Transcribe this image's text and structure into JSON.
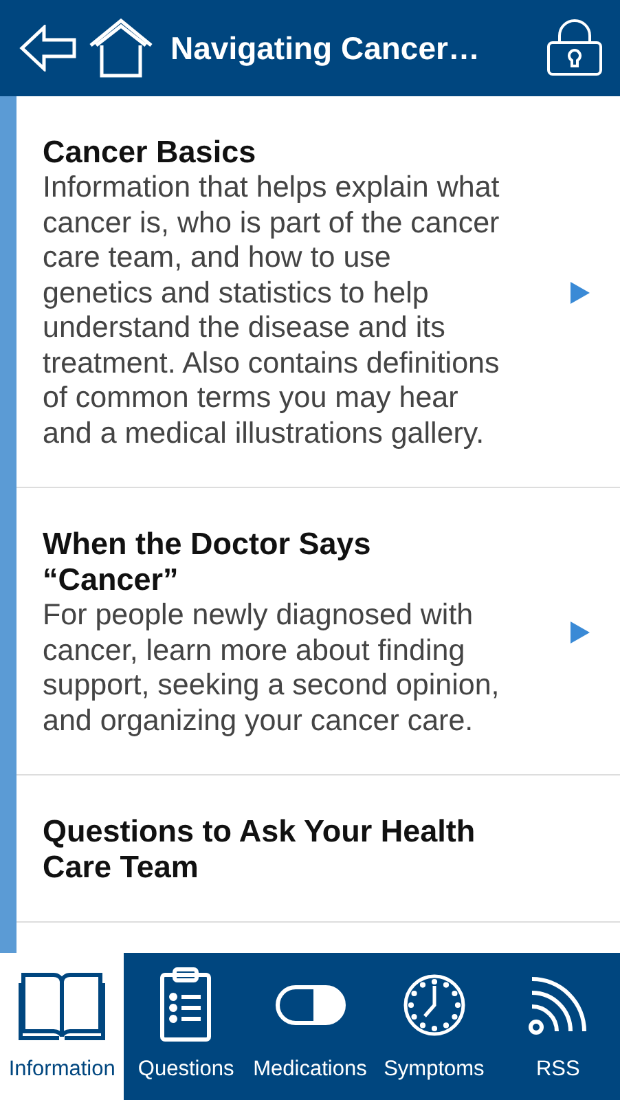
{
  "header": {
    "title": "Navigating Cancer…"
  },
  "items": [
    {
      "title": "Cancer Basics",
      "description": "Information that helps explain what cancer is, who is part of the cancer care team, and how to use genetics and statistics to help understand the disease and its treatment. Also contains definitions of common terms you may hear and a medical illustrations gallery."
    },
    {
      "title": "When the Doctor Says “Cancer”",
      "description": "For people newly diagnosed with cancer, learn more about finding support, seeking a second opinion, and organizing your cancer care."
    },
    {
      "title": "Questions to Ask Your Health Care Team"
    }
  ],
  "tabs": [
    {
      "label": "Information",
      "kind": "book",
      "selected": true
    },
    {
      "label": "Questions",
      "kind": "clipboard",
      "selected": false
    },
    {
      "label": "Medications",
      "kind": "pill",
      "selected": false
    },
    {
      "label": "Symptoms",
      "kind": "clock",
      "selected": false
    },
    {
      "label": "RSS",
      "kind": "rss",
      "selected": false
    }
  ]
}
